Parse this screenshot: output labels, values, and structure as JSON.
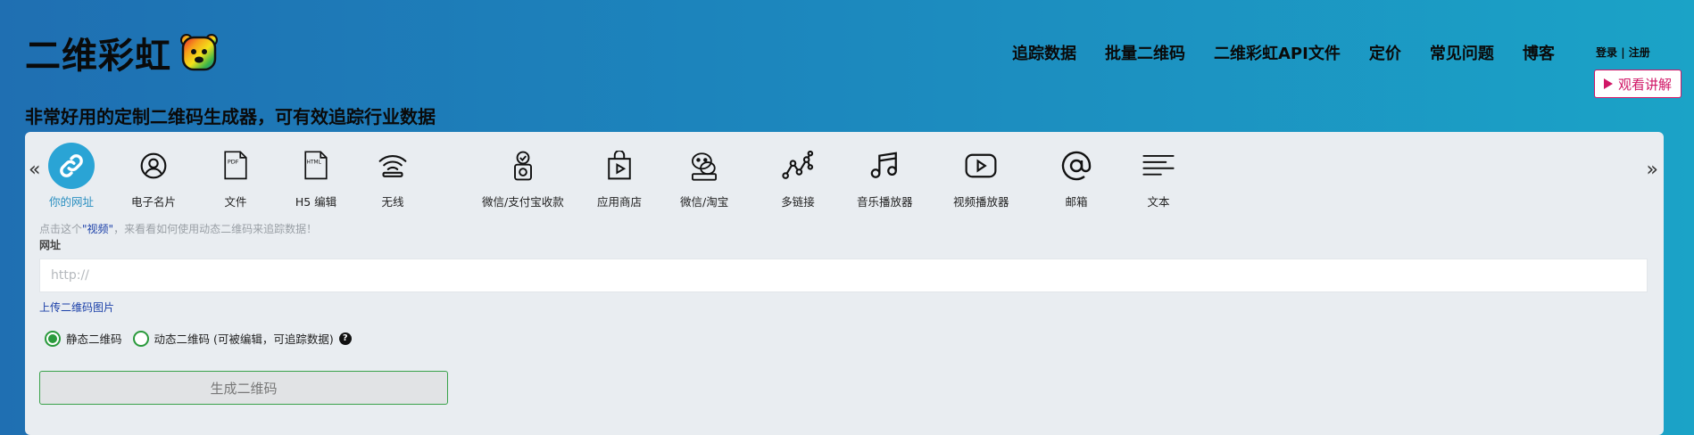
{
  "header": {
    "logo_text": "二维彩虹",
    "tagline": "非常好用的定制二维码生成器，可有效追踪行业数据",
    "nav": [
      "追踪数据",
      "批量二维码",
      "二维彩虹API文件",
      "定价",
      "常见问题",
      "博客"
    ],
    "login": "登录",
    "separator": "|",
    "register": "注册",
    "watch_label": "观看讲解"
  },
  "tabs": [
    {
      "label": "你的网址",
      "icon": "link-icon",
      "active": true
    },
    {
      "label": "电子名片",
      "icon": "person-icon"
    },
    {
      "label": "文件",
      "icon": "pdf-file-icon",
      "badge": "PDF"
    },
    {
      "label": "H5 编辑",
      "icon": "html-file-icon",
      "badge": "HTML"
    },
    {
      "label": "无线",
      "icon": "wifi-icon"
    },
    {
      "label": "微信/支付宝收款",
      "icon": "payment-icon"
    },
    {
      "label": "应用商店",
      "icon": "app-store-icon"
    },
    {
      "label": "微信/淘宝",
      "icon": "wechat-icon"
    },
    {
      "label": "多链接",
      "icon": "multi-link-icon"
    },
    {
      "label": "音乐播放器",
      "icon": "music-icon"
    },
    {
      "label": "视频播放器",
      "icon": "video-icon"
    },
    {
      "label": "邮箱",
      "icon": "email-icon"
    },
    {
      "label": "文本",
      "icon": "text-icon"
    }
  ],
  "hint": {
    "before": "点击这个",
    "link": "\"视频\"",
    "after": "，来看看如何使用动态二维码来追踪数据！"
  },
  "form": {
    "field_label": "网址",
    "url_placeholder": "http://",
    "upload_label": "上传二维码图片",
    "static_label": "静态二维码",
    "dynamic_label": "动态二维码 (可被编辑，可追踪数据)",
    "help_symbol": "?",
    "generate_label": "生成二维码",
    "selected": "static"
  },
  "colors": {
    "accent": "#2aa4d5",
    "radio": "#2a9a3c",
    "watch": "#d01666"
  }
}
